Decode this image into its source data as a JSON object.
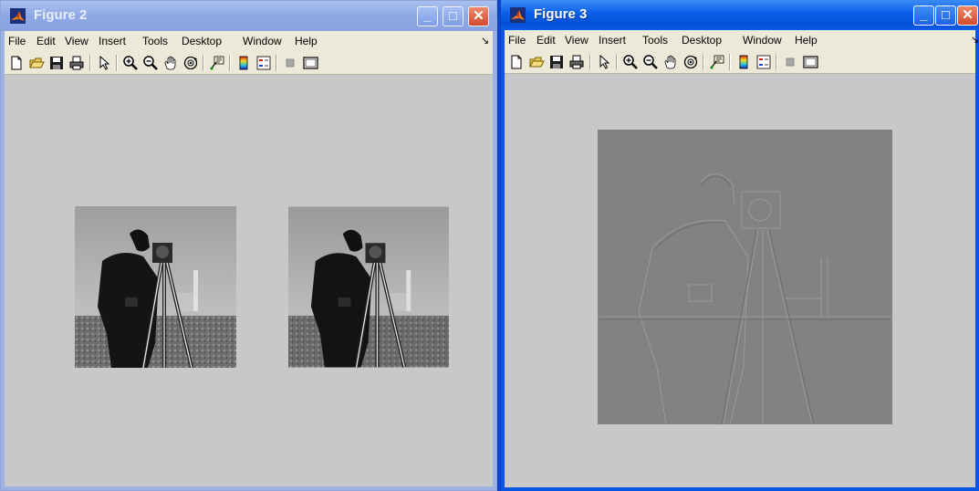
{
  "figure2": {
    "title": "Figure 2",
    "menu": [
      "File",
      "Edit",
      "View",
      "Insert",
      "Tools",
      "Desktop",
      "Window",
      "Help"
    ],
    "images": [
      "original cameraman image",
      "processed cameraman image"
    ]
  },
  "figure3": {
    "title": "Figure 3",
    "menu": [
      "File",
      "Edit",
      "View",
      "Insert",
      "Tools",
      "Desktop",
      "Window",
      "Help"
    ],
    "images": [
      "edge-detected cameraman image"
    ]
  },
  "window_buttons": {
    "minimize": "_",
    "maximize": "□",
    "close": "✕"
  },
  "icons": [
    "new-figure-icon",
    "open-file-icon",
    "save-icon",
    "print-icon",
    "select-arrow-icon",
    "zoom-in-icon",
    "zoom-out-icon",
    "pan-hand-icon",
    "rotate-3d-icon",
    "data-cursor-icon",
    "colorbar-icon",
    "legend-icon",
    "hide-plot-tools-icon",
    "show-plot-tools-icon"
  ],
  "colors": {
    "canvas": "#c8c8c8",
    "menubar": "#ece9d8",
    "active_title": "#0a5ee8",
    "inactive_title": "#9db2e3"
  }
}
